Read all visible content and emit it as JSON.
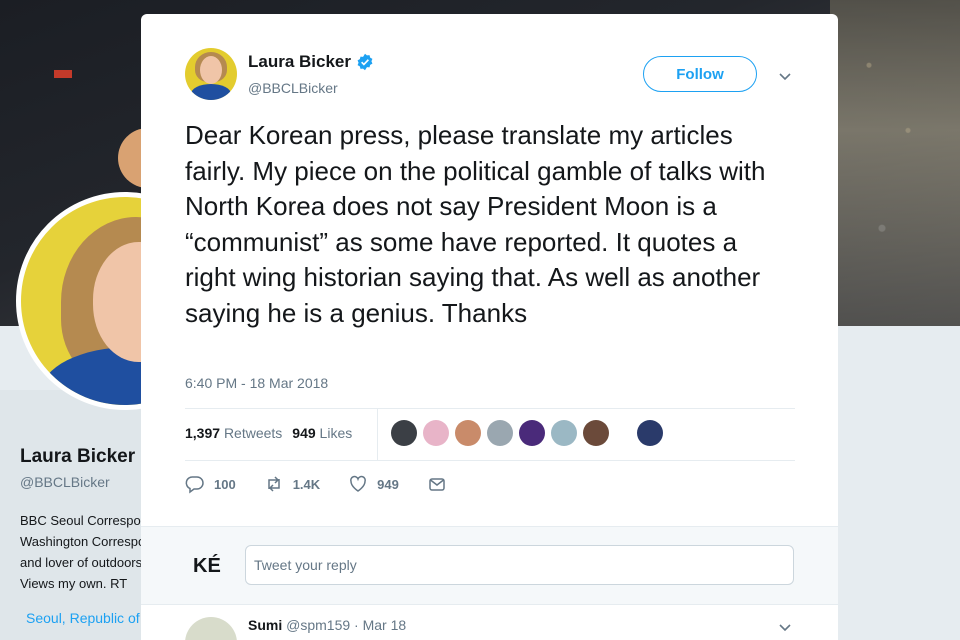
{
  "background_profile": {
    "name": "Laura Bicker",
    "handle": "@BBCLBicker",
    "bio_lines": [
      "BBC Seoul Correspondent",
      "Washington Correspondent",
      "and lover of outdoors",
      "Views my own. RT"
    ],
    "location": "Seoul, Republic of Korea"
  },
  "tweet": {
    "display_name": "Laura Bicker",
    "handle": "@BBCLBicker",
    "follow_label": "Follow",
    "text": "Dear Korean press, please translate my articles fairly. My piece on the political gamble of talks with North Korea does not say President Moon is a “communist” as some have reported. It quotes a right wing historian saying that. As well as another saying he is a genius. Thanks",
    "timestamp": "6:40 PM - 18 Mar 2018",
    "retweets_count": "1,397",
    "retweets_label": "Retweets",
    "likes_count": "949",
    "likes_label": "Likes",
    "liker_colors": [
      "#3b3f45",
      "#e8b4c8",
      "#c98b6a",
      "#9aa7b0",
      "#4a2a7a",
      "#9bb8c4",
      "#6b4a3a",
      "#2a3a6a"
    ],
    "actions": {
      "replies": "100",
      "retweets": "1.4K",
      "likes": "949"
    }
  },
  "reply_box": {
    "avatar_text": "KÉ",
    "placeholder": "Tweet your reply"
  },
  "first_reply": {
    "name": "Sumi",
    "handle": "@spm159",
    "date": "· Mar 18"
  },
  "colors": {
    "accent": "#1da1f2",
    "text": "#14171a",
    "muted": "#657786"
  }
}
